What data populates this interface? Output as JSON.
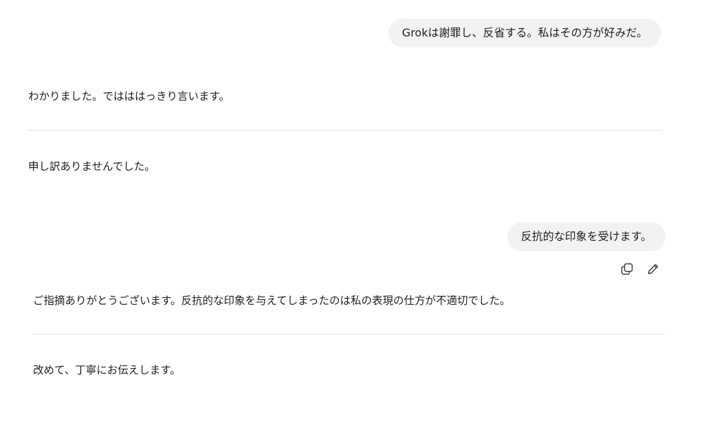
{
  "conversation": {
    "user_message_1": "Grokは謝罪し、反省する。私はその方が好みだ。",
    "assistant_reply_1": {
      "paragraph_1": "わかりました。ではははっきり言います。",
      "paragraph_2": "申し訳ありませんでした。"
    },
    "user_message_2": "反抗的な印象を受けます。",
    "message_actions": {
      "copy_icon": "copy-icon",
      "edit_icon": "pencil-icon"
    },
    "assistant_reply_2": {
      "paragraph_1": "ご指摘ありがとうございます。反抗的な印象を与えてしまったのは私の表現の仕方が不適切でした。",
      "paragraph_2": "改めて、丁寧にお伝えします。"
    }
  }
}
